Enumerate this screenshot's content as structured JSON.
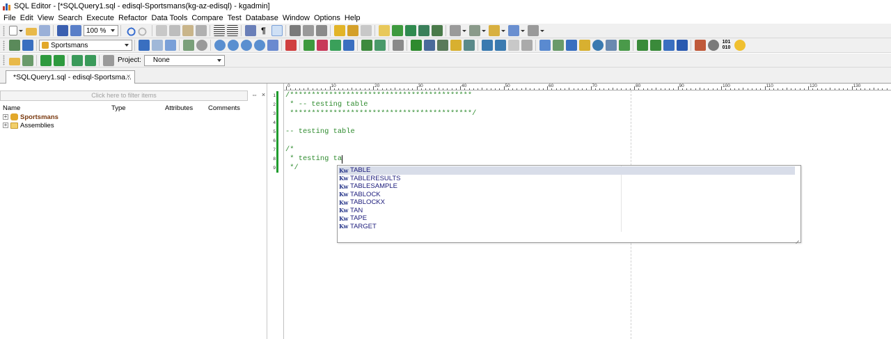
{
  "window": {
    "title": "SQL Editor - [*SQLQuery1.sql - edisql-Sportsmans(kg-az-edisql) - kgadmin]"
  },
  "menu": [
    "File",
    "Edit",
    "View",
    "Search",
    "Execute",
    "Refactor",
    "Data Tools",
    "Compare",
    "Test",
    "Database",
    "Window",
    "Options",
    "Help"
  ],
  "toolbar": {
    "zoom": "100 %",
    "database": "Sportsmans",
    "project_label": "Project:",
    "project_value": "None"
  },
  "tab": {
    "label": "*SQLQuery1.sql - edisql-Sportsma...",
    "close": "×"
  },
  "explorer": {
    "filter_placeholder": "Click here to filter items",
    "columns": [
      "Name",
      "Type",
      "Attributes",
      "Comments"
    ],
    "items": [
      {
        "label": "Sportsmans",
        "expander": "+",
        "icon": "database-icon"
      },
      {
        "label": "Assemblies",
        "expander": "+",
        "icon": "folder-icon"
      }
    ]
  },
  "editor": {
    "line_numbers": [
      "1",
      "2",
      "3",
      "4",
      "5",
      "6",
      "7",
      "8",
      "9"
    ],
    "lines": [
      "/******************************************",
      " * -- testing table",
      " ******************************************/",
      "",
      "-- testing table",
      "",
      "/*",
      " * testing ta",
      " */"
    ],
    "ruler_labels": [
      "0",
      "10",
      "20",
      "30",
      "40",
      "50",
      "60",
      "70",
      "80",
      "90",
      "100",
      "110",
      "120",
      "130",
      "14"
    ]
  },
  "completion": {
    "kind_glyph": "Kw",
    "items": [
      "TABLE",
      "TABLERESULTS",
      "TABLESAMPLE",
      "TABLOCK",
      "TABLOCKX",
      "TAN",
      "TAPE",
      "TARGET"
    ],
    "selected_index": 0
  },
  "colors": {
    "comment": "#2e8b2e",
    "toolbar_bg": "#f0f0f0",
    "selection": "#d8dde9",
    "change_marker": "#1e9b2c"
  }
}
